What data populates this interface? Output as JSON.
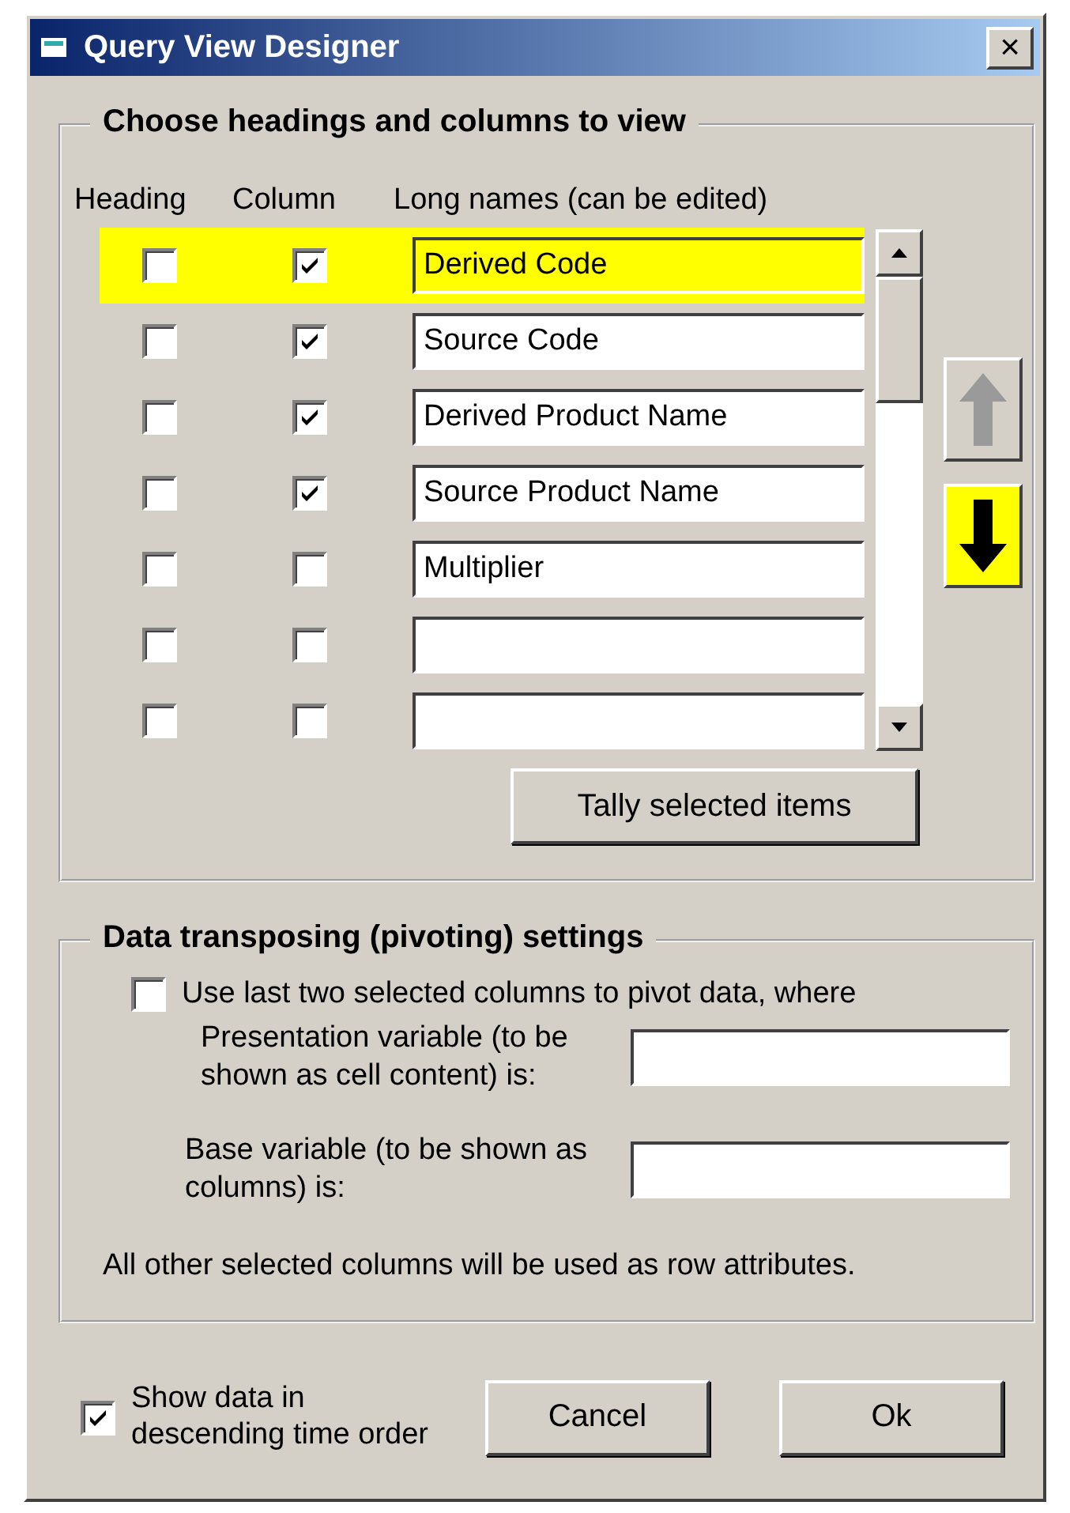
{
  "window": {
    "title": "Query View Designer",
    "close": "×"
  },
  "columns_group": {
    "title": "Choose headings and columns to view",
    "headers": [
      "Heading",
      "Column",
      "Long names (can be edited)"
    ],
    "rows": [
      {
        "heading": false,
        "column": true,
        "name": "Derived Code",
        "selected": true
      },
      {
        "heading": false,
        "column": true,
        "name": "Source Code",
        "selected": false
      },
      {
        "heading": false,
        "column": true,
        "name": "Derived Product Name",
        "selected": false
      },
      {
        "heading": false,
        "column": true,
        "name": "Source Product Name",
        "selected": false
      },
      {
        "heading": false,
        "column": false,
        "name": "Multiplier",
        "selected": false
      },
      {
        "heading": false,
        "column": false,
        "name": "",
        "selected": false
      },
      {
        "heading": false,
        "column": false,
        "name": "",
        "selected": false
      }
    ],
    "move_up": {
      "disabled": true
    },
    "move_down": {
      "disabled": false
    },
    "tally_button": "Tally selected items"
  },
  "pivot_group": {
    "title": "Data transposing (pivoting) settings",
    "use_pivot": {
      "label": "Use last two selected columns to pivot data, where",
      "checked": false
    },
    "presentation_label": "Presentation variable (to be shown as cell content) is:",
    "base_label": "Base variable (to be shown as columns) is:",
    "note": "All other selected columns will be used as row attributes."
  },
  "descending": {
    "label": "Show data in descending time order",
    "checked": true
  },
  "buttons": [
    "Cancel",
    "Ok"
  ]
}
